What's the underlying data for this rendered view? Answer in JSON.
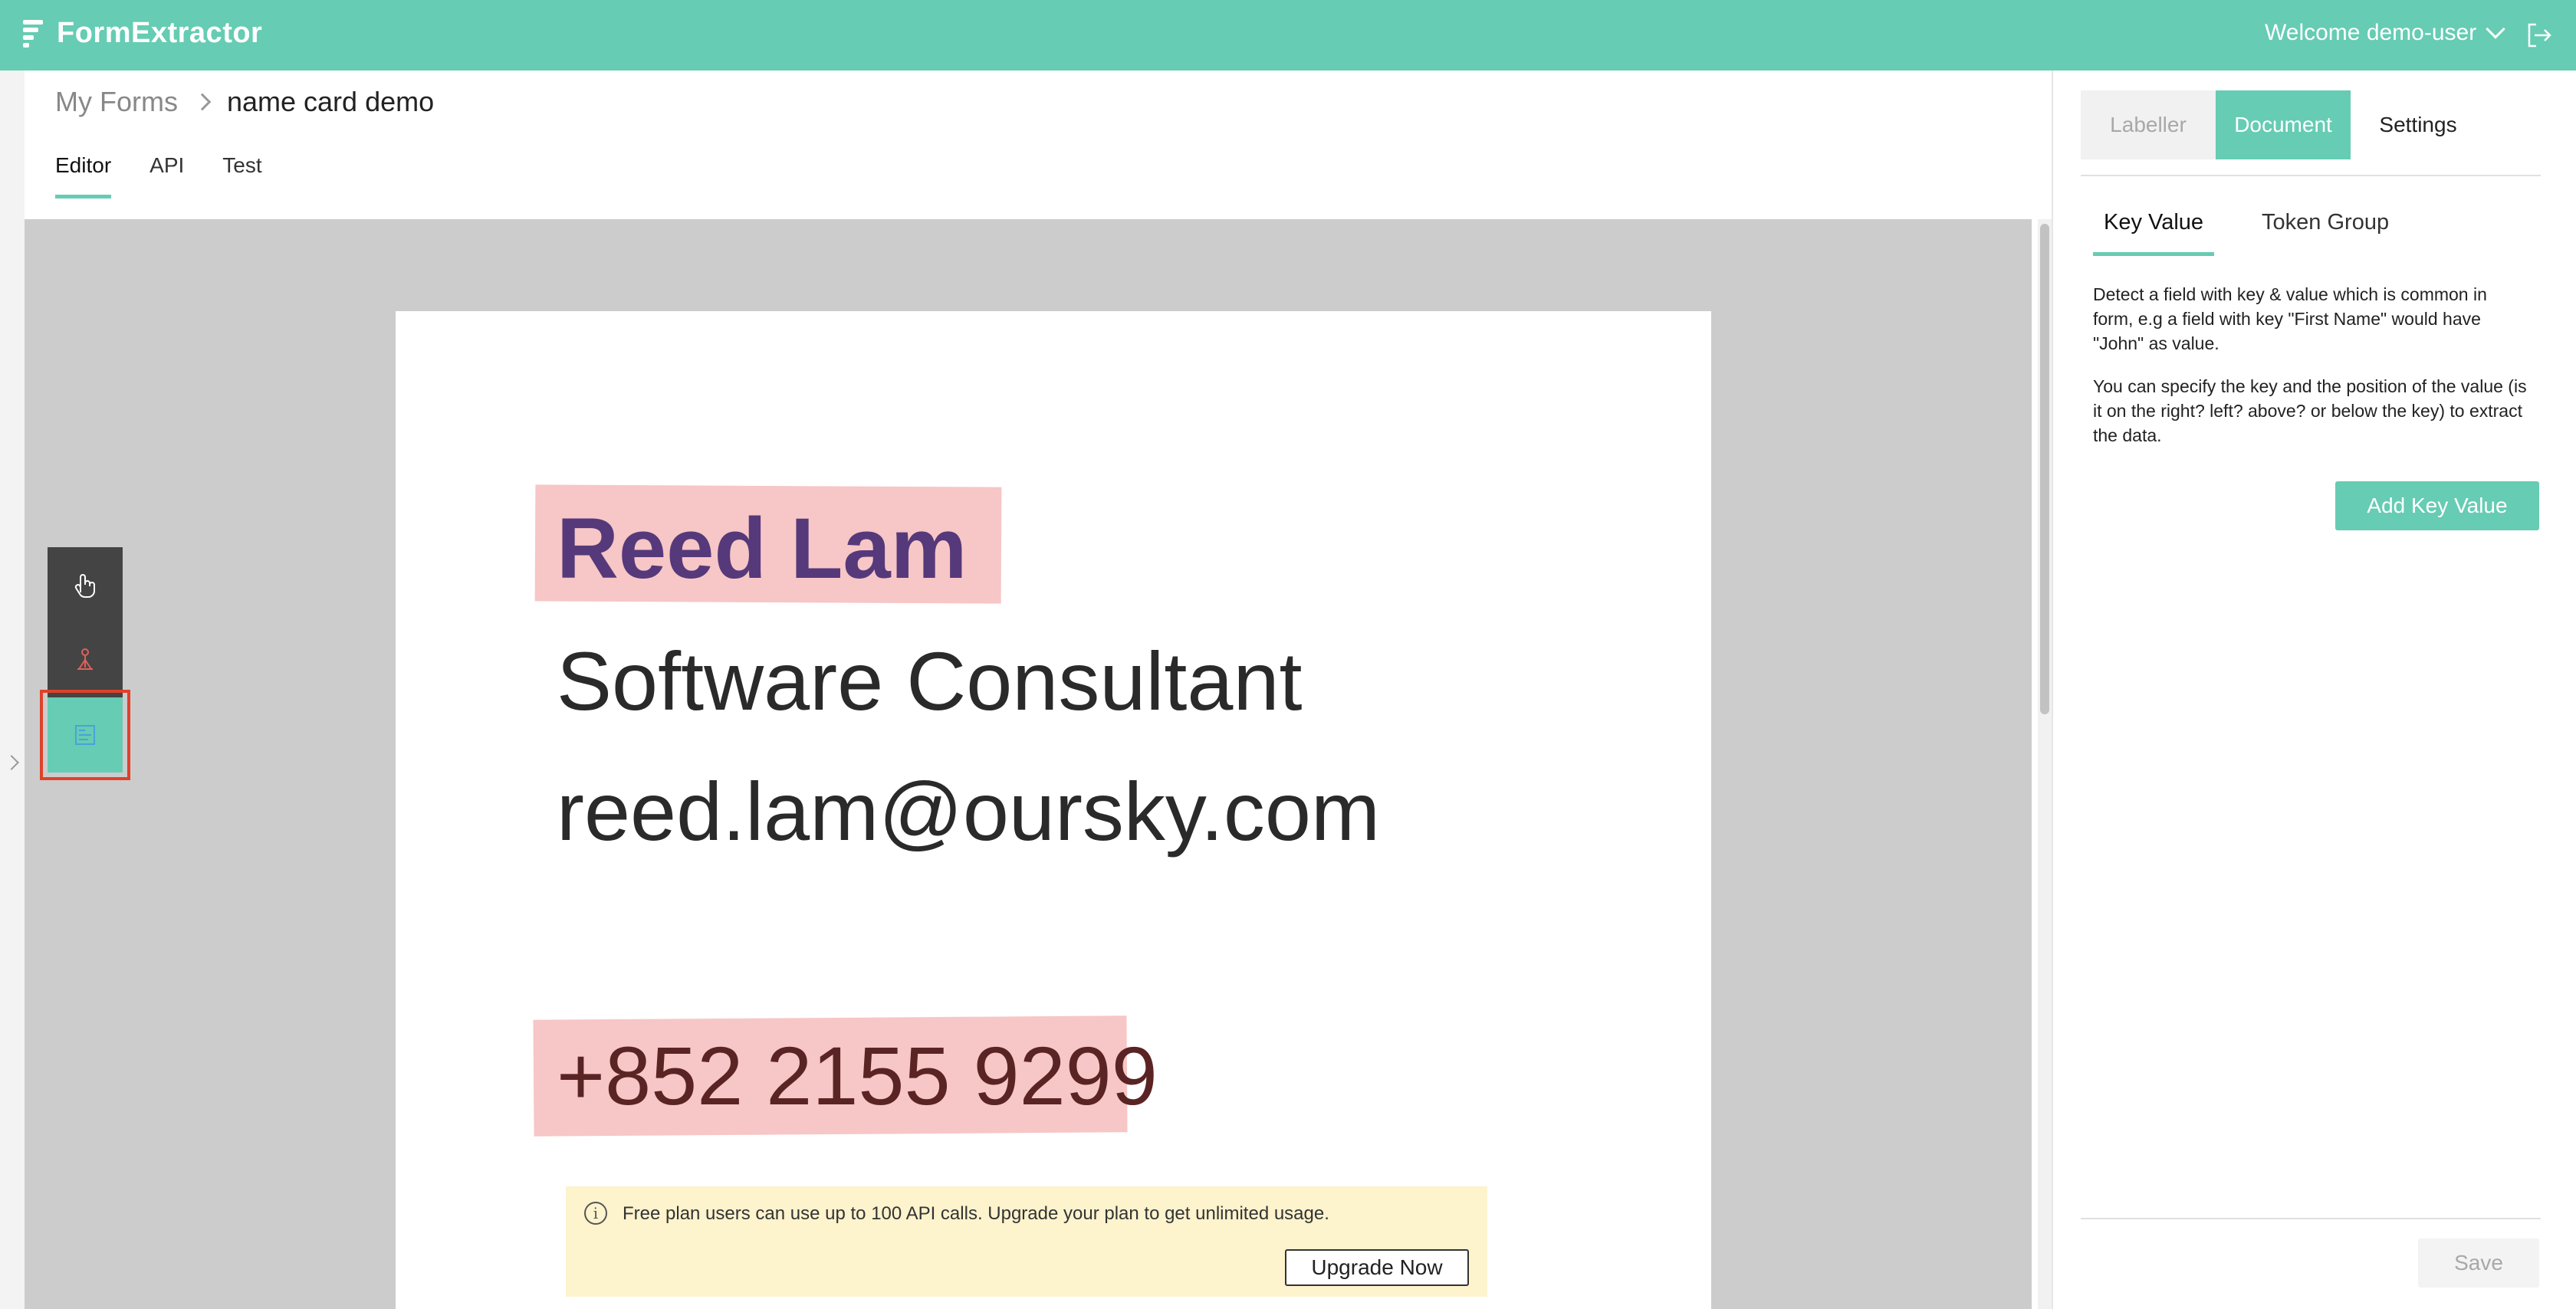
{
  "app": {
    "title": "FormExtractor",
    "welcome": "Welcome demo-user"
  },
  "breadcrumb": {
    "root": "My Forms",
    "current": "name card demo"
  },
  "tabs": [
    "Editor",
    "API",
    "Test"
  ],
  "card": {
    "name": "Reed Lam",
    "title": "Software Consultant",
    "email": "reed.lam@oursky.com",
    "phone": "+852 2155 9299"
  },
  "notice": {
    "text": "Free plan users can use up to 100 API calls. Upgrade your plan to get unlimited usage.",
    "button": "Upgrade Now"
  },
  "tools": [
    "select-tool-icon",
    "region-tool-icon",
    "token-tool-icon"
  ],
  "right_panel": {
    "segments": [
      "Labeller",
      "Document",
      "Settings"
    ],
    "sub_tabs": [
      "Key Value",
      "Token Group"
    ],
    "description1": "Detect a field with key & value which is common in form, e.g a field with key \"First Name\" would have \"John\" as value.",
    "description2": "You can specify the key and the position of the value (is it on the right? left? above? or below the key) to extract the data.",
    "add_button": "Add Key Value",
    "save_button": "Save"
  },
  "colors": {
    "brand": "#66ccb3",
    "highlight": "#f7c6c6",
    "notice_bg": "#fdf3cd",
    "selection_outline": "#e0402a"
  }
}
